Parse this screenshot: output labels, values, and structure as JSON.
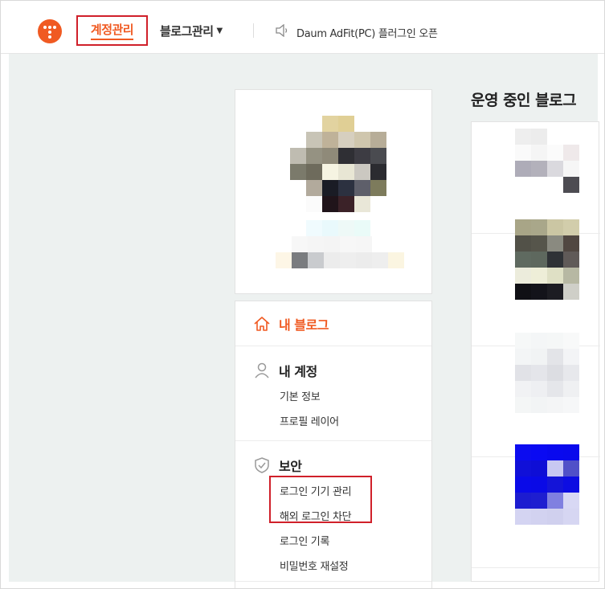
{
  "header": {
    "nav_account": "계정관리",
    "nav_blog": "블로그관리",
    "notice": "Daum AdFit(PC) 플러그인 오픈"
  },
  "sidebar": {
    "home_label": "내 블로그",
    "sections": [
      {
        "title": "내 계정",
        "items": [
          "기본 정보",
          "프로필 레이어"
        ]
      },
      {
        "title": "보안",
        "items": [
          "로그인 기기 관리",
          "해외 로그인 차단",
          "로그인 기록",
          "비밀번호 재설정"
        ]
      }
    ]
  },
  "blogs": {
    "title": "운영 중인 블로그"
  },
  "colors": {
    "accent": "#f05a22",
    "highlight": "#d0202a",
    "background": "#edf1f0"
  }
}
